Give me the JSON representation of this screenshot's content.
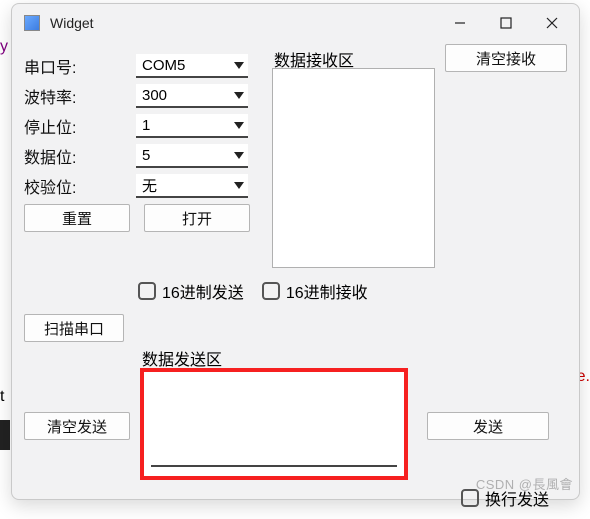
{
  "window": {
    "title": "Widget"
  },
  "edges": {
    "y": "y",
    "e": "e.",
    "t": "t"
  },
  "config": {
    "port_label": "串口号:",
    "port_value": "COM5",
    "baud_label": "波特率:",
    "baud_value": "300",
    "stopbit_label": "停止位:",
    "stopbit_value": "1",
    "databit_label": "数据位:",
    "databit_value": "5",
    "parity_label": "校验位:",
    "parity_value": "无"
  },
  "buttons": {
    "reset": "重置",
    "open": "打开",
    "scan": "扫描串口",
    "clear_recv": "清空接收",
    "clear_send": "清空发送",
    "send": "发送"
  },
  "labels": {
    "recv_area": "数据接收区",
    "send_area": "数据发送区"
  },
  "checkboxes": {
    "hex_send": "16进制发送",
    "hex_recv": "16进制接收",
    "line_send": "换行发送"
  },
  "watermark": "CSDN @長風會"
}
